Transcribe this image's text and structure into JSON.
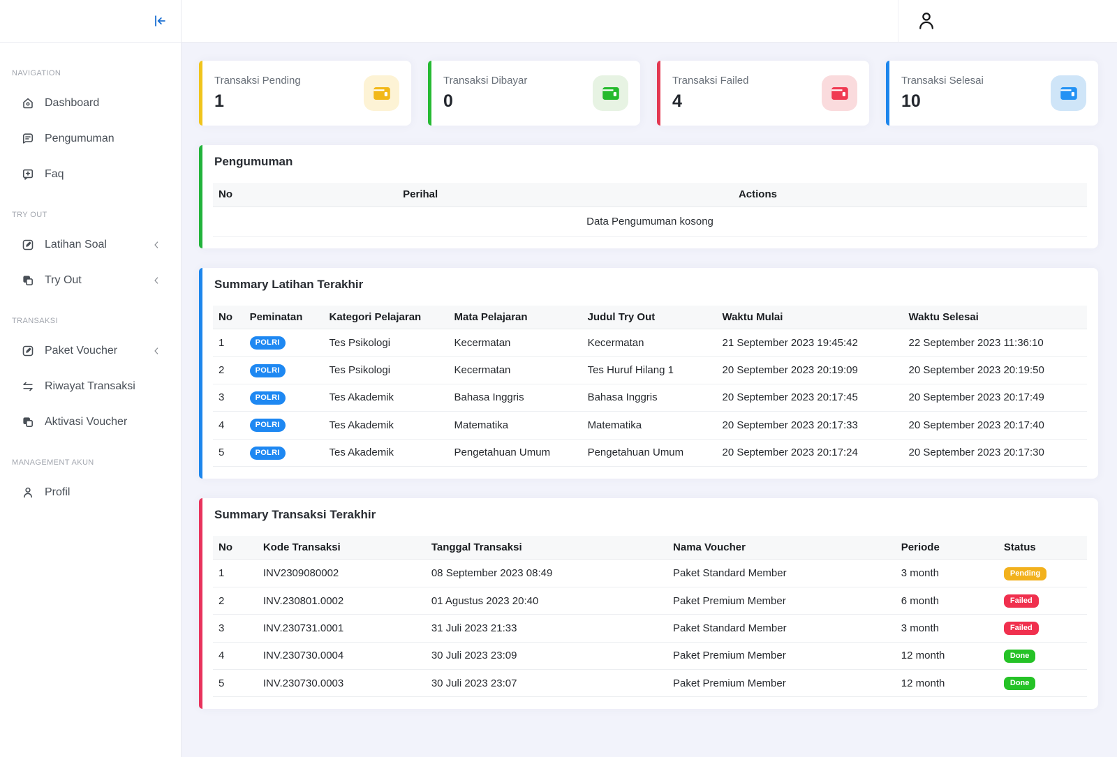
{
  "sidebar": {
    "sections": [
      {
        "label": "NAVIGATION",
        "items": [
          {
            "label": "Dashboard",
            "icon": "home-icon",
            "chevron": false
          },
          {
            "label": "Pengumuman",
            "icon": "announcement-icon",
            "chevron": false
          },
          {
            "label": "Faq",
            "icon": "faq-icon",
            "chevron": false
          }
        ]
      },
      {
        "label": "TRY OUT",
        "items": [
          {
            "label": "Latihan Soal",
            "icon": "edit-box-icon",
            "chevron": true
          },
          {
            "label": "Try Out",
            "icon": "copy-icon",
            "chevron": true
          }
        ]
      },
      {
        "label": "TRANSAKSI",
        "items": [
          {
            "label": "Paket Voucher",
            "icon": "edit-box-icon",
            "chevron": true
          },
          {
            "label": "Riwayat Transaksi",
            "icon": "transfer-icon",
            "chevron": false
          },
          {
            "label": "Aktivasi Voucher",
            "icon": "copy-icon",
            "chevron": false
          }
        ]
      },
      {
        "label": "MANAGEMENT AKUN",
        "items": [
          {
            "label": "Profil",
            "icon": "person-icon",
            "chevron": false
          }
        ]
      }
    ]
  },
  "stats": {
    "cards": [
      {
        "key": "pending",
        "label": "Transaksi Pending",
        "value": "1",
        "accent": "#f0c41c"
      },
      {
        "key": "dibayar",
        "label": "Transaksi Dibayar",
        "value": "0",
        "accent": "#26ba33"
      },
      {
        "key": "failed",
        "label": "Transaksi Failed",
        "value": "4",
        "accent": "#e33851"
      },
      {
        "key": "selesai",
        "label": "Transaksi Selesai",
        "value": "10",
        "accent": "#1d86ec"
      }
    ]
  },
  "pengumuman": {
    "title": "Pengumuman",
    "columns": {
      "no": "No",
      "perihal": "Perihal",
      "actions": "Actions"
    },
    "empty_text": "Data Pengumuman kosong",
    "accent": "#22b33b"
  },
  "latihan": {
    "title": "Summary Latihan Terakhir",
    "accent": "#1d86ec",
    "columns": {
      "no": "No",
      "peminatan": "Peminatan",
      "kategori": "Kategori Pelajaran",
      "mata": "Mata Pelajaran",
      "judul": "Judul Try Out",
      "mulai": "Waktu Mulai",
      "selesai": "Waktu Selesai"
    },
    "rows": [
      {
        "no": "1",
        "peminatan": "POLRI",
        "kategori": "Tes Psikologi",
        "mata": "Kecermatan",
        "judul": "Kecermatan",
        "mulai": "21 September 2023 19:45:42",
        "selesai": "22 September 2023 11:36:10"
      },
      {
        "no": "2",
        "peminatan": "POLRI",
        "kategori": "Tes Psikologi",
        "mata": "Kecermatan",
        "judul": "Tes Huruf Hilang 1",
        "mulai": "20 September 2023 20:19:09",
        "selesai": "20 September 2023 20:19:50"
      },
      {
        "no": "3",
        "peminatan": "POLRI",
        "kategori": "Tes Akademik",
        "mata": "Bahasa Inggris",
        "judul": "Bahasa Inggris",
        "mulai": "20 September 2023 20:17:45",
        "selesai": "20 September 2023 20:17:49"
      },
      {
        "no": "4",
        "peminatan": "POLRI",
        "kategori": "Tes Akademik",
        "mata": "Matematika",
        "judul": "Matematika",
        "mulai": "20 September 2023 20:17:33",
        "selesai": "20 September 2023 20:17:40"
      },
      {
        "no": "5",
        "peminatan": "POLRI",
        "kategori": "Tes Akademik",
        "mata": "Pengetahuan Umum",
        "judul": "Pengetahuan Umum",
        "mulai": "20 September 2023 20:17:24",
        "selesai": "20 September 2023 20:17:30"
      }
    ]
  },
  "transaksi": {
    "title": "Summary Transaksi Terakhir",
    "accent": "#e8335c",
    "columns": {
      "no": "No",
      "kode": "Kode Transaksi",
      "tanggal": "Tanggal Transaksi",
      "voucher": "Nama Voucher",
      "periode": "Periode",
      "status": "Status"
    },
    "rows": [
      {
        "no": "1",
        "kode": "INV2309080002",
        "tanggal": "08 September 2023 08:49",
        "voucher": "Paket Standard Member",
        "periode": "3 month",
        "status": "Pending"
      },
      {
        "no": "2",
        "kode": "INV.230801.0002",
        "tanggal": "01 Agustus 2023 20:40",
        "voucher": "Paket Premium Member",
        "periode": "6 month",
        "status": "Failed"
      },
      {
        "no": "3",
        "kode": "INV.230731.0001",
        "tanggal": "31 Juli 2023 21:33",
        "voucher": "Paket Standard Member",
        "periode": "3 month",
        "status": "Failed"
      },
      {
        "no": "4",
        "kode": "INV.230730.0004",
        "tanggal": "30 Juli 2023 23:09",
        "voucher": "Paket Premium Member",
        "periode": "12 month",
        "status": "Done"
      },
      {
        "no": "5",
        "kode": "INV.230730.0003",
        "tanggal": "30 Juli 2023 23:07",
        "voucher": "Paket Premium Member",
        "periode": "12 month",
        "status": "Done"
      }
    ]
  },
  "colors": {
    "background": "#f2f3fb",
    "accent_yellow": "#f0c41c",
    "accent_green": "#26ba33",
    "accent_red": "#e33851",
    "accent_blue": "#1d86ec",
    "badge_blue": "#1e88f2",
    "badge_pending": "#f2b11d",
    "badge_failed": "#f0304e",
    "badge_done": "#25c226",
    "collapse_icon_blue": "#1c70d2"
  }
}
